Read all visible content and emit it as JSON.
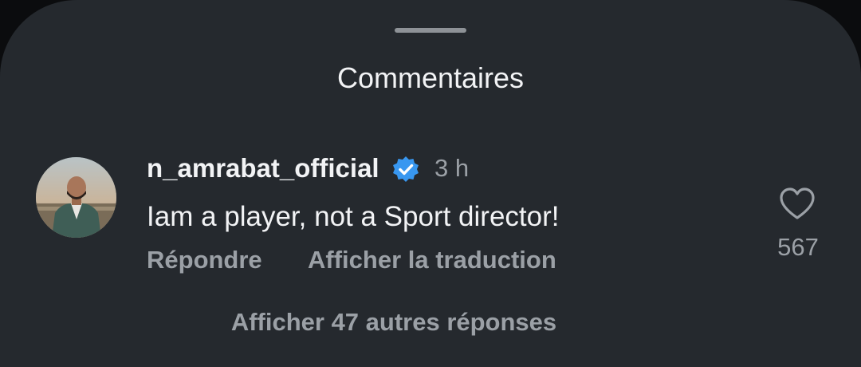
{
  "sheet": {
    "title": "Commentaires"
  },
  "comment": {
    "username": "n_amrabat_official",
    "verified_icon": "verified-badge-icon",
    "timestamp": "3 h",
    "text": "Iam a player, not a Sport director!",
    "reply_label": "Répondre",
    "translate_label": "Afficher la traduction",
    "like_icon": "heart-outline-icon",
    "like_count": "567",
    "view_replies_label": "Afficher 47 autres réponses"
  },
  "colors": {
    "background": "#25292e",
    "primary_text": "#f2f3f5",
    "secondary_text": "#9ba0a6",
    "verified_blue": "#3897f0"
  }
}
